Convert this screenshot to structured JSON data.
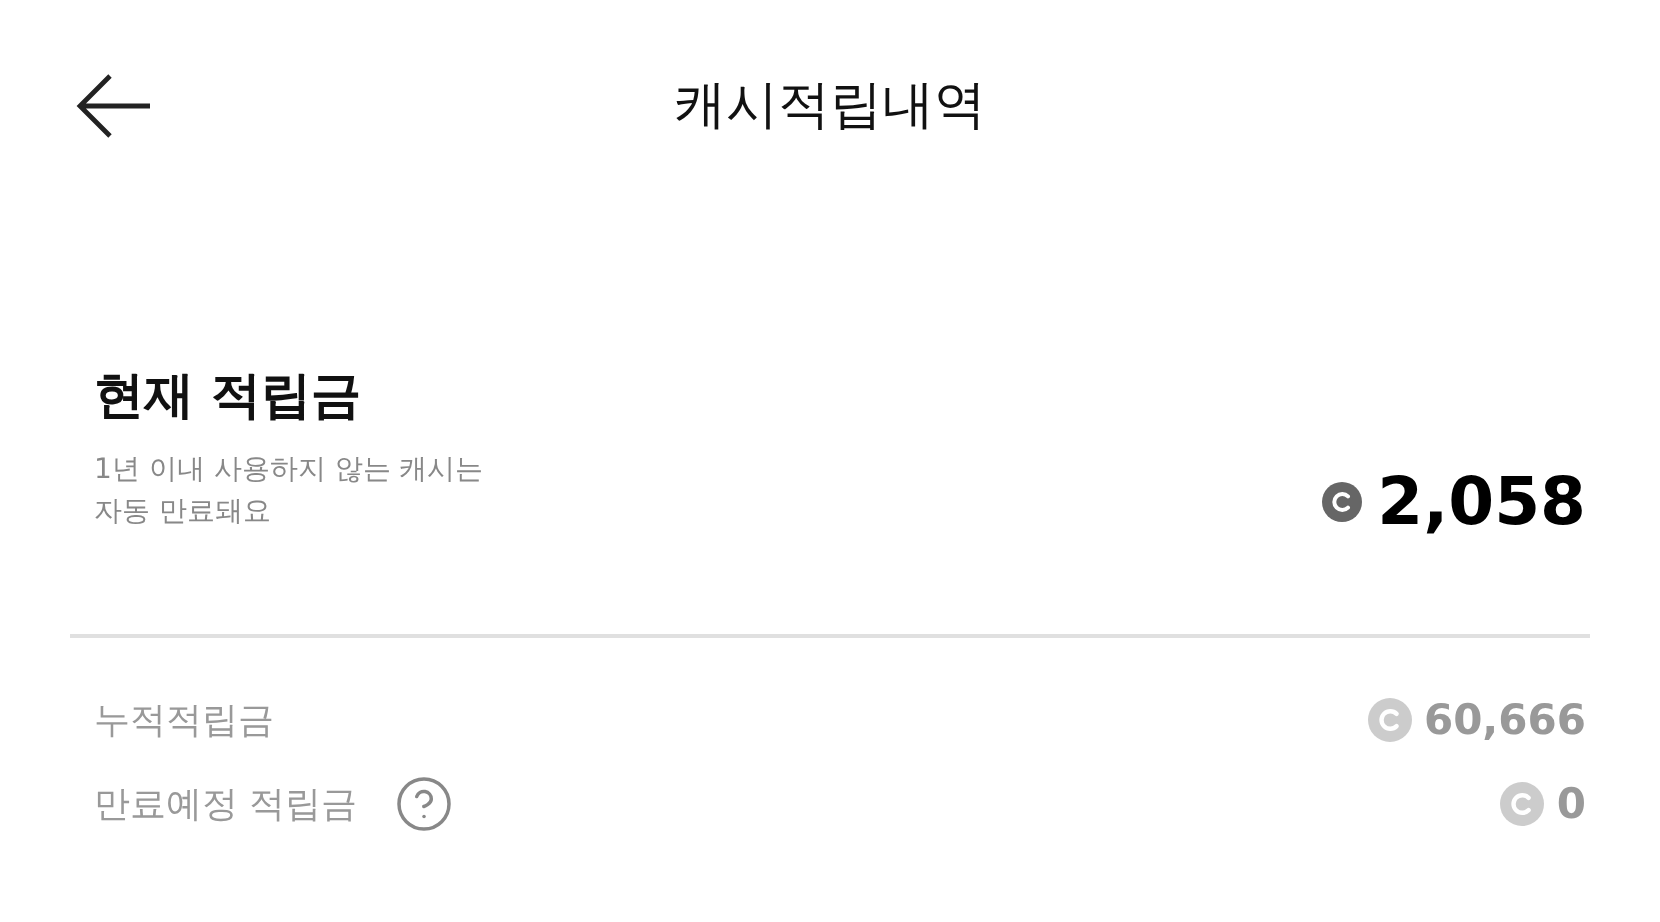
{
  "header": {
    "title": "캐시적립내역"
  },
  "balance": {
    "heading": "현재 적립금",
    "note_lines": [
      "1년 이내 사용하지 않는 캐시는",
      "자동 만료돼요"
    ],
    "amount": "2,058"
  },
  "rows": [
    {
      "label": "누적적립금",
      "help": false,
      "amount": "60,666"
    },
    {
      "label": "만료예정 적립금",
      "help": true,
      "amount": "0"
    }
  ]
}
